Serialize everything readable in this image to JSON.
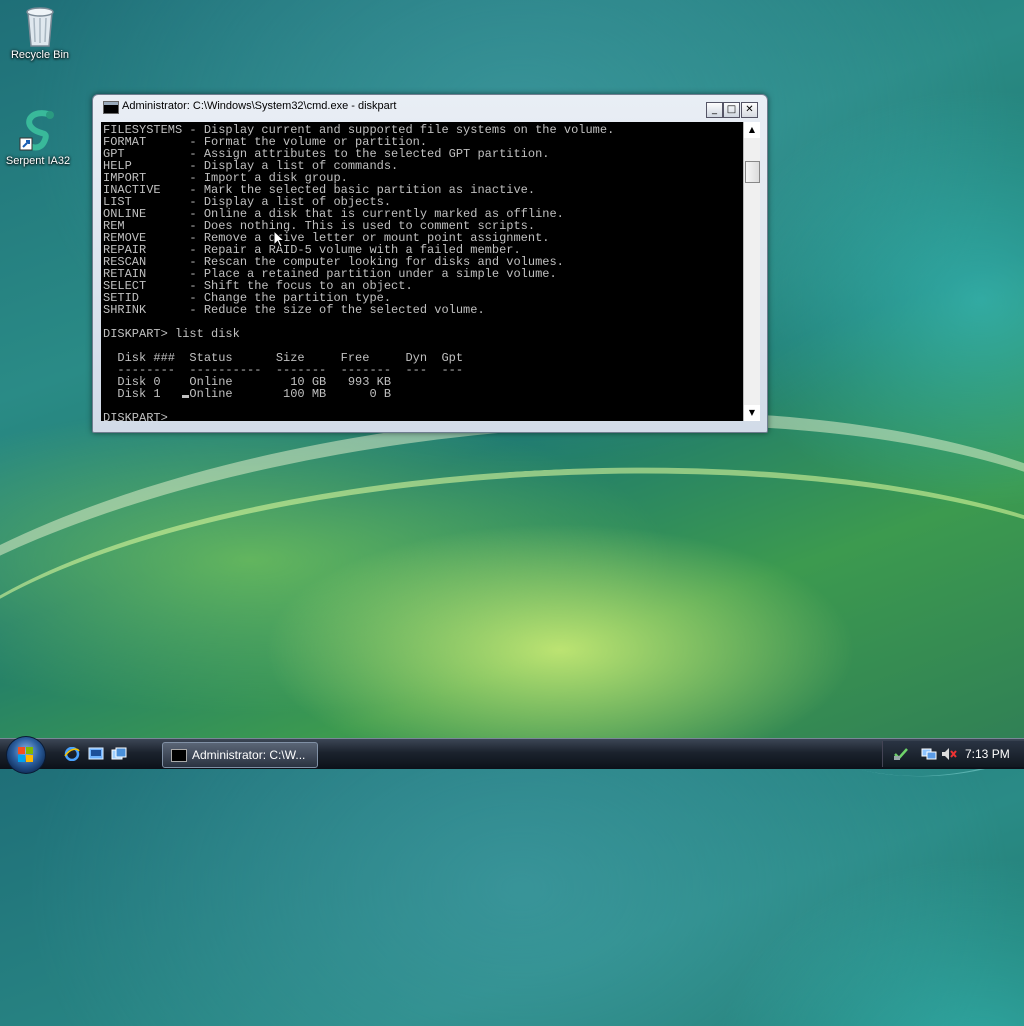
{
  "desktop": {
    "icons": [
      {
        "label": "Recycle Bin"
      },
      {
        "label": "Serpent IA32"
      }
    ]
  },
  "window": {
    "title": "Administrator: C:\\Windows\\System32\\cmd.exe - diskpart",
    "minimize_glyph": "_",
    "maximize_glyph": "□",
    "close_glyph": "✕",
    "console_lines": [
      "FILESYSTEMS - Display current and supported file systems on the volume.",
      "FORMAT      - Format the volume or partition.",
      "GPT         - Assign attributes to the selected GPT partition.",
      "HELP        - Display a list of commands.",
      "IMPORT      - Import a disk group.",
      "INACTIVE    - Mark the selected basic partition as inactive.",
      "LIST        - Display a list of objects.",
      "ONLINE      - Online a disk that is currently marked as offline.",
      "REM         - Does nothing. This is used to comment scripts.",
      "REMOVE      - Remove a drive letter or mount point assignment.",
      "REPAIR      - Repair a RAID-5 volume with a failed member.",
      "RESCAN      - Rescan the computer looking for disks and volumes.",
      "RETAIN      - Place a retained partition under a simple volume.",
      "SELECT      - Shift the focus to an object.",
      "SETID       - Change the partition type.",
      "SHRINK      - Reduce the size of the selected volume.",
      "",
      "DISKPART> list disk",
      "",
      "  Disk ###  Status      Size     Free     Dyn  Gpt",
      "  --------  ----------  -------  -------  ---  ---",
      "  Disk 0    Online        10 GB   993 KB",
      "  Disk 1    Online       100 MB      0 B",
      "",
      "DISKPART> "
    ],
    "scroll_up_glyph": "▲",
    "scroll_down_glyph": "▼"
  },
  "taskbar": {
    "task_label": "Administrator: C:\\W...",
    "clock": "7:13 PM"
  }
}
